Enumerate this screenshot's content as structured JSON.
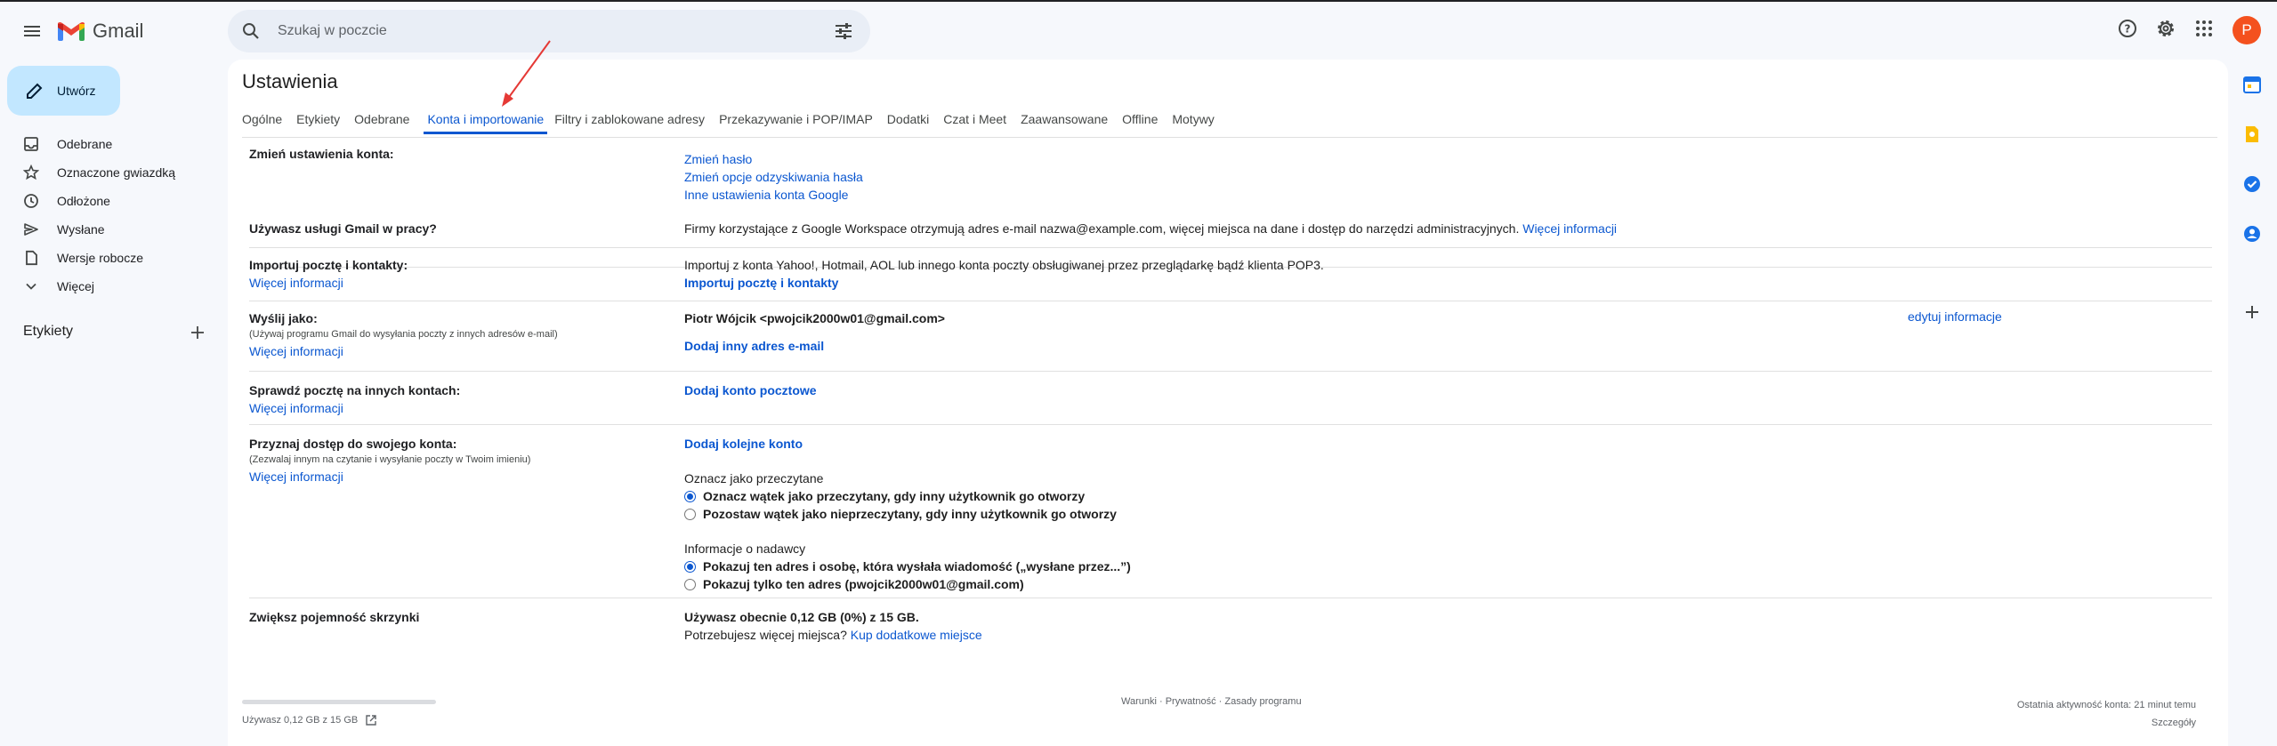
{
  "app": {
    "name": "Gmail",
    "avatar_letter": "P",
    "avatar_color": "#f4511e",
    "accent": "#0b57d0"
  },
  "search": {
    "placeholder": "Szukaj w poczcie"
  },
  "compose": {
    "label": "Utwórz"
  },
  "nav": [
    {
      "label": "Odebrane",
      "icon": "inbox-icon"
    },
    {
      "label": "Oznaczone gwiazdką",
      "icon": "star-icon"
    },
    {
      "label": "Odłożone",
      "icon": "clock-icon"
    },
    {
      "label": "Wysłane",
      "icon": "send-icon"
    },
    {
      "label": "Wersje robocze",
      "icon": "draft-icon"
    },
    {
      "label": "Więcej",
      "icon": "chevron-down-icon"
    }
  ],
  "labels": {
    "title": "Etykiety"
  },
  "settings": {
    "title": "Ustawienia",
    "tabs": [
      "Ogólne",
      "Etykiety",
      "Odebrane",
      "Konta i importowanie",
      "Filtry i zablokowane adresy",
      "Przekazywanie i POP/IMAP",
      "Dodatki",
      "Czat i Meet",
      "Zaawansowane",
      "Offline",
      "Motywy"
    ],
    "active_tab": "Konta i importowanie",
    "change_account": {
      "label": "Zmień ustawienia konta:",
      "links": [
        "Zmień hasło",
        "Zmień opcje odzyskiwania hasła",
        "Inne ustawienia konta Google"
      ]
    },
    "workspace": {
      "label": "Używasz usługi Gmail w pracy?",
      "text": "Firmy korzystające z Google Workspace otrzymują adres e-mail nazwa@example.com, więcej miejsca na dane i dostęp do narzędzi administracyjnych.",
      "link": "Więcej informacji"
    },
    "import": {
      "label": "Importuj pocztę i kontakty:",
      "more": "Więcej informacji",
      "text": "Importuj z konta Yahoo!, Hotmail, AOL lub innego konta poczty obsługiwanej przez przeglądarkę bądź klienta POP3.",
      "action": "Importuj pocztę i kontakty"
    },
    "send_as": {
      "label": "Wyślij jako:",
      "sub": "(Używaj programu Gmail do wysyłania poczty z innych adresów e-mail)",
      "more": "Więcej informacji",
      "address": "Piotr Wójcik <pwojcik2000w01@gmail.com>",
      "add": "Dodaj inny adres e-mail",
      "edit": "edytuj informacje"
    },
    "check_mail": {
      "label": "Sprawdź pocztę na innych kontach:",
      "more": "Więcej informacji",
      "action": "Dodaj konto pocztowe"
    },
    "grant": {
      "label": "Przyznaj dostęp do swojego konta:",
      "sub": "(Zezwalaj innym na czytanie i wysyłanie poczty w Twoim imieniu)",
      "more": "Więcej informacji",
      "add": "Dodaj kolejne konto",
      "mark_title": "Oznacz jako przeczytane",
      "mark_opt1": "Oznacz wątek jako przeczytany, gdy inny użytkownik go otworzy",
      "mark_opt2": "Pozostaw wątek jako nieprzeczytany, gdy inny użytkownik go otworzy",
      "sender_title": "Informacje o nadawcy",
      "sender_opt1": "Pokazuj ten adres i osobę, która wysłała wiadomość („wysłane przez...”)",
      "sender_opt2": "Pokazuj tylko ten adres (pwojcik2000w01@gmail.com)"
    },
    "storage": {
      "label": "Zwiększ pojemność skrzynki",
      "usage": "Używasz obecnie 0,12 GB (0%) z 15 GB.",
      "need": "Potrzebujesz więcej miejsca?",
      "buy": "Kup dodatkowe miejsce"
    }
  },
  "footer": {
    "usage": "Używasz 0,12 GB z 15 GB",
    "usage_percent": 0,
    "terms": "Warunki",
    "privacy": "Prywatność",
    "policy": "Zasady programu",
    "sep": " · ",
    "last_activity": "Ostatnia aktywność konta: 21 minut temu",
    "details": "Szczegóły"
  }
}
